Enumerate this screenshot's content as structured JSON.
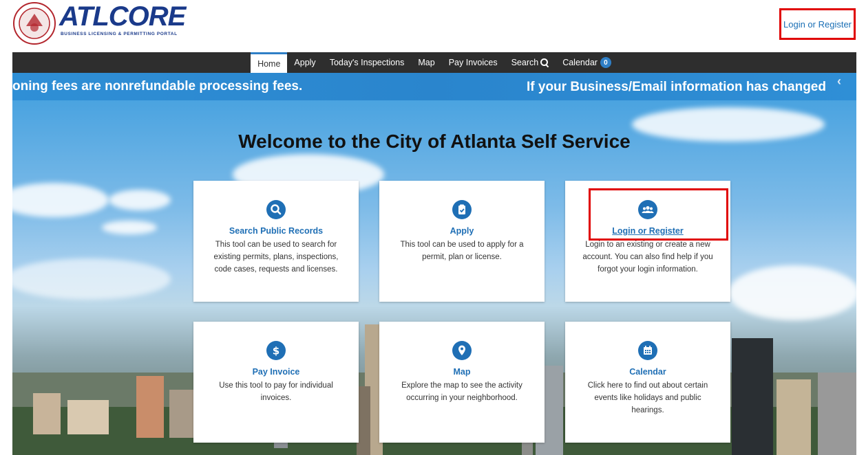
{
  "header": {
    "logo_primary": "ATLCORE",
    "logo_tagline": "BUSINESS LICENSING & PERMITTING PORTAL",
    "login_link": "Login or Register"
  },
  "nav": {
    "items": [
      {
        "label": "Home",
        "active": true
      },
      {
        "label": "Apply"
      },
      {
        "label": "Today's Inspections"
      },
      {
        "label": "Map"
      },
      {
        "label": "Pay Invoices"
      },
      {
        "label": "Search"
      },
      {
        "label": "Calendar",
        "badge": "0"
      }
    ]
  },
  "ticker": {
    "left_text": "oning fees are nonrefundable processing fees.",
    "right_text": "If your Business/Email information has changed",
    "prev_arrow": "‹"
  },
  "main": {
    "welcome": "Welcome to the City of Atlanta Self Service",
    "cards": [
      {
        "icon": "search-icon",
        "title": "Search Public Records",
        "desc": "This tool can be used to search for existing permits, plans, inspections, code cases, requests and licenses."
      },
      {
        "icon": "clipboard-icon",
        "title": "Apply",
        "desc": "This tool can be used to apply for a permit, plan or license."
      },
      {
        "icon": "users-icon",
        "title": "Login or Register",
        "desc": "Login to an existing or create a new account. You can also find help if you forgot your login information."
      },
      {
        "icon": "dollar-icon",
        "title": "Pay Invoice",
        "desc": "Use this tool to pay for individual invoices."
      },
      {
        "icon": "map-pin-icon",
        "title": "Map",
        "desc": "Explore the map to see the activity occurring in your neighborhood."
      },
      {
        "icon": "calendar-icon",
        "title": "Calendar",
        "desc": "Click here to find out about certain events like holidays and public hearings."
      }
    ]
  },
  "colors": {
    "brand": "#1a3a8a",
    "accent": "#1f6fb5",
    "nav_bg": "#2e2e2e",
    "ticker_bg": "#2f8fd6",
    "highlight": "#e00000"
  }
}
